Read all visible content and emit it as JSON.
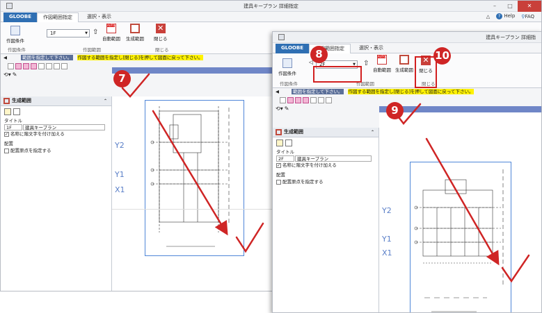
{
  "window1": {
    "title": "建具キープラン 詳細指定",
    "tabs": [
      "GLOOBE",
      "作図範囲指定",
      "選択・表示"
    ],
    "help": "Help",
    "faq": "FAQ",
    "ribbon": {
      "draw_condition": "作図条件",
      "floor_value": "1F",
      "auto_range": "自動範囲",
      "gen_range": "生成範囲",
      "close": "閉じる",
      "group_draw_condition": "作図条件",
      "group_draw_range": "作図範囲",
      "group_close": "閉じる"
    },
    "message": {
      "dark": "範囲を指定して下さい。",
      "highlight": "作図する範囲を指定し[閉じる]を押して図面に戻って下さい。"
    },
    "panel": {
      "header": "生成範囲",
      "title_label": "タイトル",
      "title_floor": "1F",
      "title_name": "建具キープラン",
      "add_floor_name": "名称に階文字を付け加える",
      "placement_label": "配置",
      "placement_origin": "配置原点を指定する"
    },
    "axes": [
      "Y2",
      "Y1",
      "X1"
    ]
  },
  "window2": {
    "title": "建具キープラン 詳細指",
    "tabs": [
      "GLOOBE",
      "作図範囲指定",
      "選択・表示"
    ],
    "ribbon": {
      "draw_condition": "作図条件",
      "floor_value": "2F",
      "auto_range": "自動範囲",
      "gen_range": "生成範囲",
      "close": "閉じる",
      "group_draw_condition": "作図条件",
      "group_draw_range": "作図範囲",
      "group_close": "閉じる"
    },
    "message": {
      "dark": "範囲を指定して下さい。",
      "highlight": "作図する範囲を指定し[閉じる]を押して図面に戻って下さい。"
    },
    "panel": {
      "header": "生成範囲",
      "title_label": "タイトル",
      "title_floor": "2F",
      "title_name": "建具キープラン",
      "add_floor_name": "名称に階文字を付け加える",
      "placement_label": "配置",
      "placement_origin": "配置原点を指定する"
    },
    "axes": [
      "Y2",
      "Y1",
      "X1"
    ]
  },
  "steps": [
    "7",
    "8",
    "9",
    "10"
  ],
  "colors": {
    "accent_red": "#cf2525",
    "file_tab": "#2f6fb3",
    "axis_blue": "#5a7fc8",
    "highlight": "#fff200"
  }
}
